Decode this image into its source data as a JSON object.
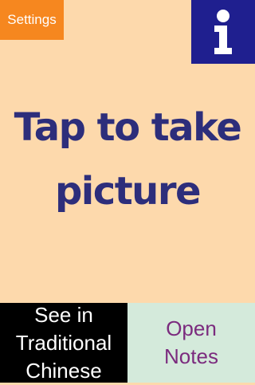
{
  "header": {
    "settings_label": "Settings",
    "info_icon": "info-icon"
  },
  "main": {
    "prompt": "Tap to take\npicture"
  },
  "footer": {
    "traditional_label": "See in\nTraditional\nChinese",
    "notes_label": "Open\nNotes"
  },
  "colors": {
    "background": "#fdd9ac",
    "settings_bg": "#f6871f",
    "info_bg": "#1f1f8f",
    "prompt_text": "#2d2e7b",
    "traditional_bg": "#000000",
    "notes_bg": "#d4eadb",
    "notes_text": "#7b2b7e"
  }
}
